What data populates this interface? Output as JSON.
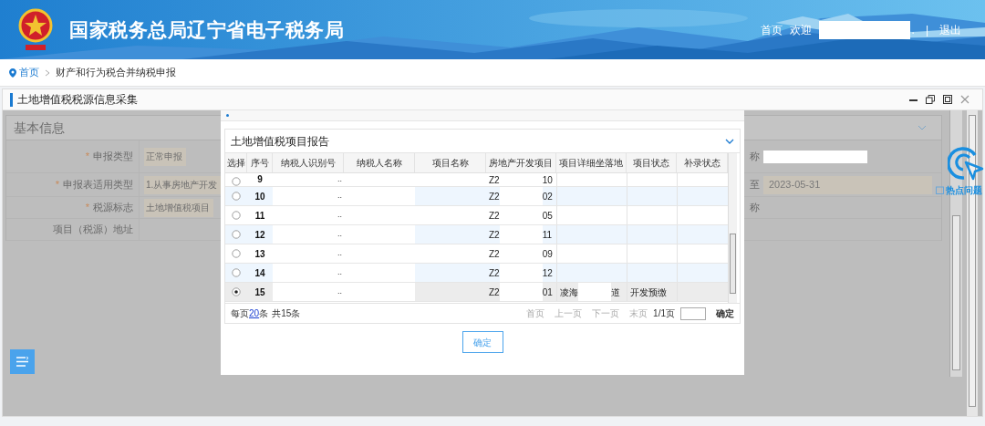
{
  "header": {
    "title": "国家税务总局辽宁省电子税务局",
    "home": "首页",
    "welcome": "欢迎",
    "dot": ".",
    "separator": "|",
    "logout": "退出"
  },
  "breadcrumb": {
    "home": "首页",
    "current": "财产和行为税合并纳税申报"
  },
  "panel": {
    "title": "土地增值税税源信息采集"
  },
  "form": {
    "section": "基本信息",
    "rows": [
      {
        "label": "申报类型",
        "required_mark": "*",
        "value": "正常申报"
      },
      {
        "label": "申报表适用类型",
        "required_mark": "*",
        "value": "1.从事房地产开发"
      },
      {
        "label": "税源标志",
        "required_mark": "*",
        "value": "土地增值税项目"
      },
      {
        "label": "项目（税源）地址"
      }
    ],
    "right_labels": [
      "称",
      "至",
      "称"
    ],
    "date": "2023-05-31"
  },
  "hot_issue": "热点问题",
  "dialog": {
    "title": "土地增值税项目报告",
    "columns": [
      "选择",
      "序号",
      "纳税人识别号",
      "纳税人名称",
      "项目名称",
      "房地产开发项目",
      "项目详细坐落地",
      "项目状态",
      "补录状态"
    ],
    "rows": [
      {
        "no": "9",
        "selected": false,
        "id_tail": "..",
        "dev_prefix": "Z2",
        "dev_suffix": "10"
      },
      {
        "no": "10",
        "selected": false,
        "id_tail": "..",
        "dev_prefix": "Z2",
        "dev_suffix": "02"
      },
      {
        "no": "11",
        "selected": false,
        "id_tail": "..",
        "dev_prefix": "Z2",
        "dev_suffix": "05"
      },
      {
        "no": "12",
        "selected": false,
        "id_tail": "..",
        "dev_prefix": "Z2",
        "dev_suffix": "11"
      },
      {
        "no": "13",
        "selected": false,
        "id_tail": "..",
        "dev_prefix": "Z2",
        "dev_suffix": "09"
      },
      {
        "no": "14",
        "selected": false,
        "id_tail": "..",
        "dev_prefix": "Z2",
        "dev_suffix": "12"
      },
      {
        "no": "15",
        "selected": true,
        "id_tail": "..",
        "dev_prefix": "Z2",
        "dev_suffix": "01",
        "location_prefix": "凌海",
        "location_suffix": "道",
        "status": "开发预缴"
      }
    ],
    "pagination": {
      "per_page_prefix": "每页",
      "per_page": "20",
      "per_page_suffix": "条",
      "total": "共15条",
      "first": "首页",
      "prev": "上一页",
      "next": "下一页",
      "last": "末页",
      "pages": "1/1页",
      "go": "确定"
    },
    "confirm": "确定"
  }
}
